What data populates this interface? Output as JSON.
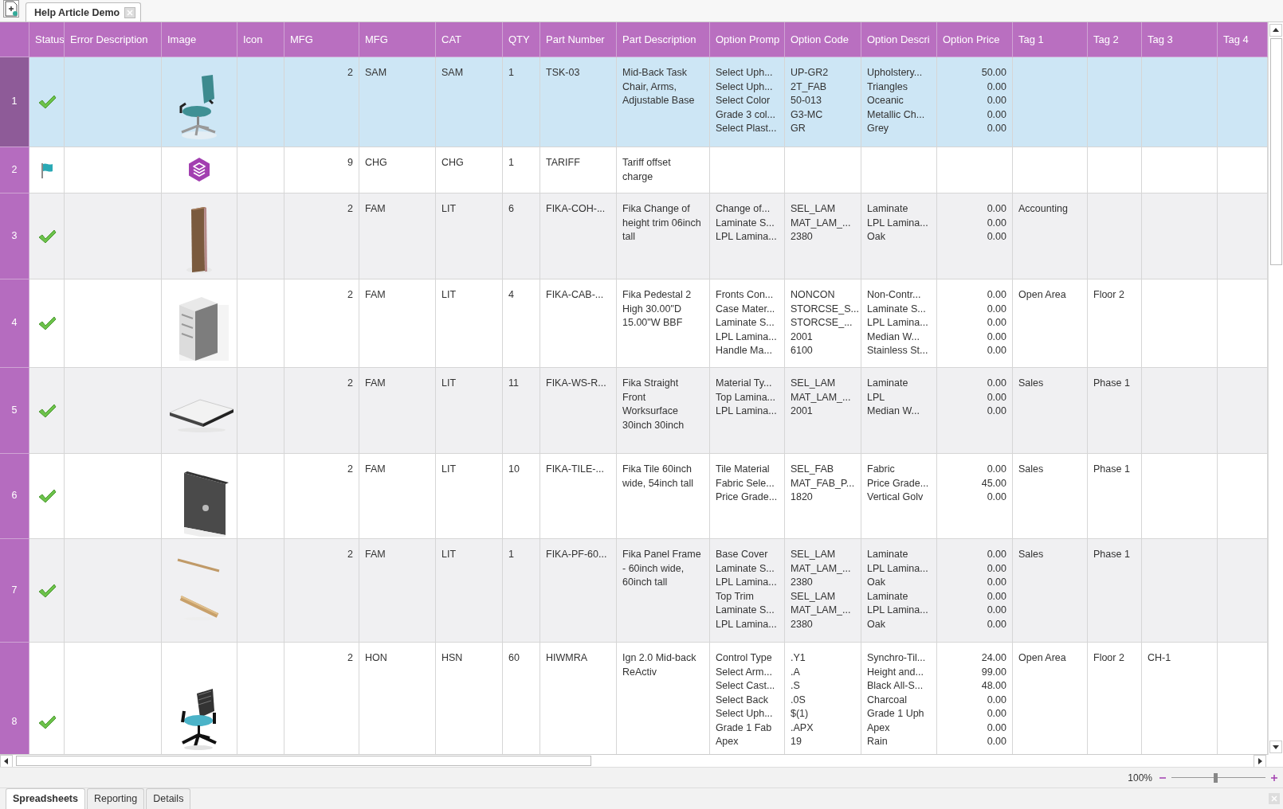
{
  "document_tabs": [
    {
      "label": "Help Article Demo",
      "selected": true
    }
  ],
  "table": {
    "columns": [
      "Status",
      "Error Description",
      "Image",
      "Icon",
      "MFG",
      "MFG",
      "CAT",
      "QTY",
      "Part Number",
      "Part Description",
      "Option Promp",
      "Option Code",
      "Option Descri",
      "Option Price",
      "Tag 1",
      "Tag 2",
      "Tag 3",
      "Tag 4"
    ],
    "rows": [
      {
        "number": "1",
        "selected": true,
        "status": {
          "kind": "check"
        },
        "image": {
          "kind": "picture"
        },
        "mfg_1": "2",
        "mfg_2": "SAM",
        "cat": "SAM",
        "qty": "1",
        "part_number": "TSK-03",
        "part_description": "Mid-Back Task Chair, Arms, Adjustable Base",
        "options": [
          {
            "prompt": "Select  Uph...",
            "code": "UP-GR2",
            "description": "Upholstery...",
            "price": "50.00"
          },
          {
            "prompt": "Select  Uph...",
            "code": "2T_FAB",
            "description": "Triangles",
            "price": "0.00"
          },
          {
            "prompt": "Select Color",
            "code": "50-013",
            "description": "Oceanic",
            "price": "0.00"
          },
          {
            "prompt": "Grade 3 col...",
            "code": "G3-MC",
            "description": "Metallic  Ch...",
            "price": "0.00"
          },
          {
            "prompt": "Select  Plast...",
            "code": "GR",
            "description": "Grey",
            "price": "0.00"
          }
        ]
      },
      {
        "number": "2",
        "selected": false,
        "status": {
          "kind": "flag"
        },
        "image": {
          "kind": "icon"
        },
        "mfg_1": "9",
        "mfg_2": "CHG",
        "cat": "CHG",
        "qty": "1",
        "part_number": "TARIFF",
        "part_description": "Tariff offset charge"
      },
      {
        "number": "3",
        "selected": false,
        "status": {
          "kind": "check"
        },
        "image": {
          "kind": "picture"
        },
        "mfg_1": "2",
        "mfg_2": "FAM",
        "cat": "LIT",
        "qty": "6",
        "part_number": "FIKA-COH-...",
        "part_description": "Fika Change of height trim 06inch tall",
        "options": [
          {
            "prompt": "Change  of...",
            "code": "SEL_LAM",
            "description": "Laminate",
            "price": "0.00"
          },
          {
            "prompt": "Laminate  S...",
            "code": "MAT_LAM_...",
            "description": "LPL  Lamina...",
            "price": "0.00"
          },
          {
            "prompt": "LPL  Lamina...",
            "code": "2380",
            "description": "Oak",
            "price": "0.00"
          }
        ],
        "tag_1": "Accounting"
      },
      {
        "number": "4",
        "selected": false,
        "status": {
          "kind": "check"
        },
        "image": {
          "kind": "picture"
        },
        "mfg_1": "2",
        "mfg_2": "FAM",
        "cat": "LIT",
        "qty": "4",
        "part_number": "FIKA-CAB-...",
        "part_description": "Fika Pedestal 2 High 30.00\"D 15.00\"W BBF",
        "options": [
          {
            "prompt": "Fronts  Con...",
            "code": "NONCON",
            "description": "Non-Contr...",
            "price": "0.00"
          },
          {
            "prompt": "Case Mater...",
            "code": "STORCSE_S...",
            "description": "Laminate  S...",
            "price": "0.00"
          },
          {
            "prompt": "Laminate  S...",
            "code": "STORCSE_...",
            "description": "LPL  Lamina...",
            "price": "0.00"
          },
          {
            "prompt": "LPL  Lamina...",
            "code": "2001",
            "description": "Median  W...",
            "price": "0.00"
          },
          {
            "prompt": "Handle  Ma...",
            "code": "6100",
            "description": "Stainless  St...",
            "price": "0.00"
          }
        ],
        "tag_1": "Open Area",
        "tag_2": "Floor 2"
      },
      {
        "number": "5",
        "selected": false,
        "status": {
          "kind": "check"
        },
        "image": {
          "kind": "picture"
        },
        "mfg_1": "2",
        "mfg_2": "FAM",
        "cat": "LIT",
        "qty": "11",
        "part_number": "FIKA-WS-R...",
        "part_description": "Fika Straight Front Worksurface 30inch 30inch",
        "options": [
          {
            "prompt": "Material  Ty...",
            "code": "SEL_LAM",
            "description": "Laminate",
            "price": "0.00"
          },
          {
            "prompt": "Top  Lamina...",
            "code": "MAT_LAM_...",
            "description": "LPL",
            "price": "0.00"
          },
          {
            "prompt": "LPL  Lamina...",
            "code": "2001",
            "description": "Median  W...",
            "price": "0.00"
          }
        ],
        "tag_1": "Sales",
        "tag_2": "Phase 1"
      },
      {
        "number": "6",
        "selected": false,
        "status": {
          "kind": "check"
        },
        "image": {
          "kind": "picture"
        },
        "mfg_1": "2",
        "mfg_2": "FAM",
        "cat": "LIT",
        "qty": "10",
        "part_number": "FIKA-TILE-...",
        "part_description": "Fika Tile 60inch wide, 54inch tall",
        "options": [
          {
            "prompt": "Tile Material",
            "code": "SEL_FAB",
            "description": "Fabric",
            "price": "0.00"
          },
          {
            "prompt": "Fabric  Sele...",
            "code": "MAT_FAB_P...",
            "description": "Price  Grade...",
            "price": "45.00"
          },
          {
            "prompt": "Price  Grade...",
            "code": "1820",
            "description": "Vertical Golv",
            "price": "0.00"
          }
        ],
        "tag_1": "Sales",
        "tag_2": "Phase 1"
      },
      {
        "number": "7",
        "selected": false,
        "status": {
          "kind": "check"
        },
        "image": {
          "kind": "picture"
        },
        "mfg_1": "2",
        "mfg_2": "FAM",
        "cat": "LIT",
        "qty": "1",
        "part_number": "FIKA-PF-60...",
        "part_description": "Fika Panel Frame - 60inch wide, 60inch tall",
        "options": [
          {
            "prompt": "Base Cover",
            "code": "SEL_LAM",
            "description": "Laminate",
            "price": "0.00"
          },
          {
            "prompt": "Laminate  S...",
            "code": "MAT_LAM_...",
            "description": "LPL  Lamina...",
            "price": "0.00"
          },
          {
            "prompt": "LPL  Lamina...",
            "code": "2380",
            "description": "Oak",
            "price": "0.00"
          },
          {
            "prompt": "Top Trim",
            "code": "SEL_LAM",
            "description": "Laminate",
            "price": "0.00"
          },
          {
            "prompt": "Laminate  S...",
            "code": "MAT_LAM_...",
            "description": "LPL  Lamina...",
            "price": "0.00"
          },
          {
            "prompt": "LPL  Lamina...",
            "code": "2380",
            "description": "Oak",
            "price": "0.00"
          }
        ],
        "tag_1": "Sales",
        "tag_2": "Phase 1"
      },
      {
        "number": "8",
        "selected": false,
        "status": {
          "kind": "check"
        },
        "image": {
          "kind": "picture"
        },
        "mfg_1": "2",
        "mfg_2": "HON",
        "cat": "HSN",
        "qty": "60",
        "part_number": "HIWMRA",
        "part_description": "Ign 2.0 Mid-back ReActiv",
        "options": [
          {
            "prompt": "Control Type",
            "code": ".Y1",
            "description": "Synchro-Til...",
            "price": "24.00"
          },
          {
            "prompt": "Select  Arm...",
            "code": ".A",
            "description": "Height  and...",
            "price": "99.00"
          },
          {
            "prompt": "Select  Cast...",
            "code": ".S",
            "description": "Black  All-S...",
            "price": "48.00"
          },
          {
            "prompt": "Select Back",
            "code": ".0S",
            "description": "Charcoal",
            "price": "0.00"
          },
          {
            "prompt": "Select  Uph...",
            "code": "$(1)",
            "description": "Grade 1 Uph",
            "price": "0.00"
          },
          {
            "prompt": "Grade 1 Fab",
            "code": ".APX",
            "description": "Apex",
            "price": "0.00"
          },
          {
            "prompt": "Apex",
            "code": "19",
            "description": "Rain",
            "price": "0.00"
          }
        ],
        "tag_1": "Open Area",
        "tag_2": "Floor 2",
        "tag_3": "CH-1"
      }
    ]
  },
  "zoom": {
    "reading": "100%",
    "level": 0.47
  },
  "sheet_tabs": [
    {
      "label": "Spreadsheets",
      "selected": true
    },
    {
      "label": "Reporting",
      "selected": false
    },
    {
      "label": "Details",
      "selected": false
    }
  ]
}
